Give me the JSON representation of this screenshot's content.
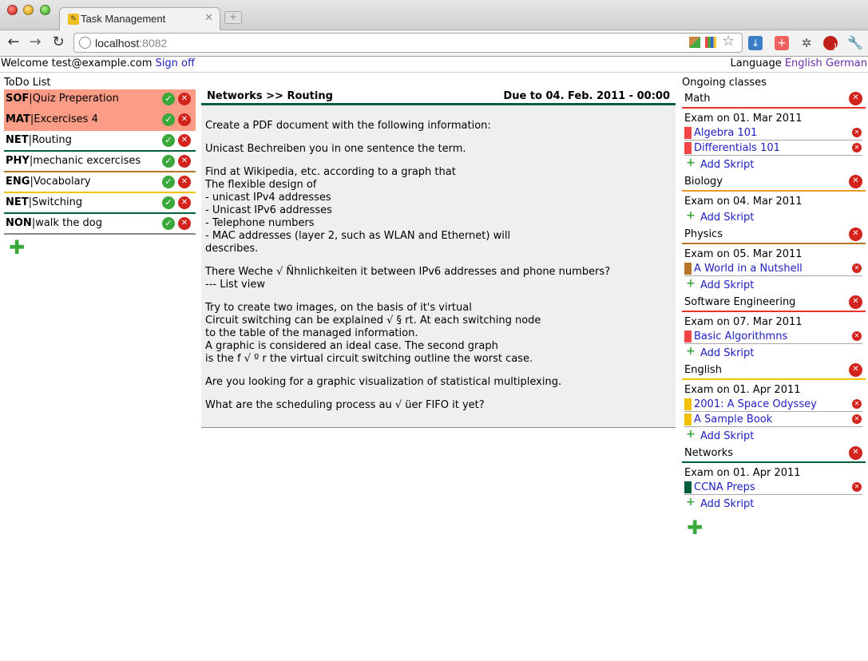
{
  "browser": {
    "tab_title": "Task Management",
    "url_host": "localhost",
    "url_port": ":8082",
    "extension_badge": "1"
  },
  "header": {
    "welcome": "Welcome test@example.com",
    "sign_off": "Sign off",
    "language_label": "Language",
    "languages": [
      "English",
      "German"
    ]
  },
  "todo": {
    "title": "ToDo List",
    "items": [
      {
        "code": "SOF",
        "text": "Quiz Preperation",
        "highlight": "#fb9c86",
        "line": "#fb9c86"
      },
      {
        "code": "MAT",
        "text": "Excercises 4",
        "highlight": "#fb9c86",
        "line": "#fb9c86"
      },
      {
        "code": "NET",
        "text": "Routing",
        "highlight": "",
        "line": "#005f3a"
      },
      {
        "code": "PHY",
        "text": "mechanic excercises",
        "highlight": "",
        "line": "#b5762a"
      },
      {
        "code": "ENG",
        "text": "Vocabolary",
        "highlight": "",
        "line": "#f2c200"
      },
      {
        "code": "NET",
        "text": "Switching",
        "highlight": "",
        "line": "#005f3a"
      },
      {
        "code": "NON",
        "text": "walk the dog",
        "highlight": "",
        "line": "#888888"
      }
    ]
  },
  "task": {
    "breadcrumb": "Networks >> Routing",
    "due": "Due to 04. Feb. 2011 - 00:00",
    "paragraphs": [
      "Create a PDF document with the following information:",
      "Unicast Bechreiben you in one sentence the term.",
      "Find at Wikipedia, etc. according to a graph that\nThe flexible design of\n- unicast IPv4 addresses\n- Unicast IPv6 addresses\n- Telephone numbers\n- MAC addresses (layer 2, such as WLAN and Ethernet) will\ndescribes.",
      "There Weche √ Ñhnlichkeiten it between IPv6 addresses and phone numbers?\n--- List view",
      "Try to create two images, on the basis of it's virtual\nCircuit switching can be explained √ § rt. At each switching node\nto the table of the managed information.\nA graphic is considered an ideal case. The second graph\nis the f √ º r the virtual circuit switching outline the worst case.",
      "Are you looking for a graphic visualization of statistical multiplexing.",
      "What are the scheduling process au √ üer FIFO it yet?"
    ]
  },
  "classes": {
    "title": "Ongoing classes",
    "add_skript_label": "Add Skript",
    "list": [
      {
        "name": "Math",
        "color": "#e8322d",
        "exam": "Exam on 01. Mar 2011",
        "skripts": [
          {
            "name": "Algebra 101",
            "color": "#f04545"
          },
          {
            "name": "Differentials 101",
            "color": "#f04545"
          }
        ]
      },
      {
        "name": "Biology",
        "color": "#e89a2a",
        "exam": "Exam on 04. Mar 2011",
        "skripts": []
      },
      {
        "name": "Physics",
        "color": "#b5762a",
        "exam": "Exam on 05. Mar 2011",
        "skripts": [
          {
            "name": "A World in a Nutshell",
            "color": "#b5762a"
          }
        ]
      },
      {
        "name": "Software Engineering",
        "color": "#e8322d",
        "exam": "Exam on 07. Mar 2011",
        "skripts": [
          {
            "name": "Basic Algorithmns",
            "color": "#f04545"
          }
        ]
      },
      {
        "name": "English",
        "color": "#f2c200",
        "exam": "Exam on 01. Apr 2011",
        "skripts": [
          {
            "name": "2001: A Space Odyssey",
            "color": "#f2c200"
          },
          {
            "name": "A Sample Book",
            "color": "#f2c200"
          }
        ]
      },
      {
        "name": "Networks",
        "color": "#005f3a",
        "exam": "Exam on 01. Apr 2011",
        "skripts": [
          {
            "name": "CCNA Preps",
            "color": "#005f3a"
          }
        ]
      }
    ]
  }
}
